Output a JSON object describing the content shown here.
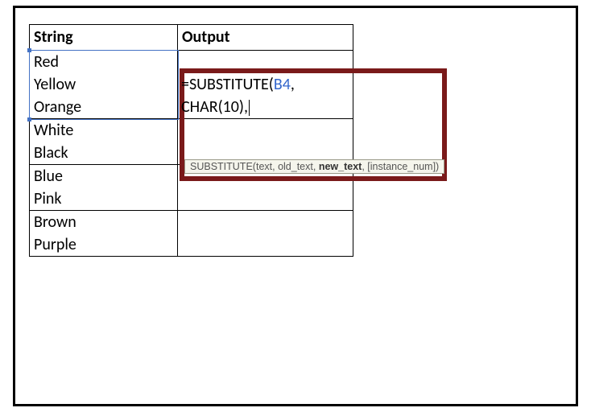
{
  "headers": {
    "string": "String",
    "output": "Output"
  },
  "rows": {
    "r1": {
      "string": "Red\nYellow\nOrange"
    },
    "r2": {
      "string": "White\nBlack"
    },
    "r3": {
      "string": "Blue\nPink"
    },
    "r4": {
      "string": "Brown\nPurple"
    }
  },
  "formula": {
    "eq": "=",
    "fn": "SUBSTITUTE",
    "open": "(",
    "ref": "B4",
    "comma1": ",",
    "fn2": "CHAR",
    "open2": "(",
    "num": "10",
    "close2": ")",
    "comma2": ","
  },
  "tooltip": {
    "fn": "SUBSTITUTE",
    "a_open": "(",
    "a_text": "text",
    "sep1": ", ",
    "a_old": "old_text",
    "sep2": ", ",
    "a_new": "new_text",
    "sep3": ", ",
    "a_inst": "[instance_num]",
    "a_close": ")"
  }
}
